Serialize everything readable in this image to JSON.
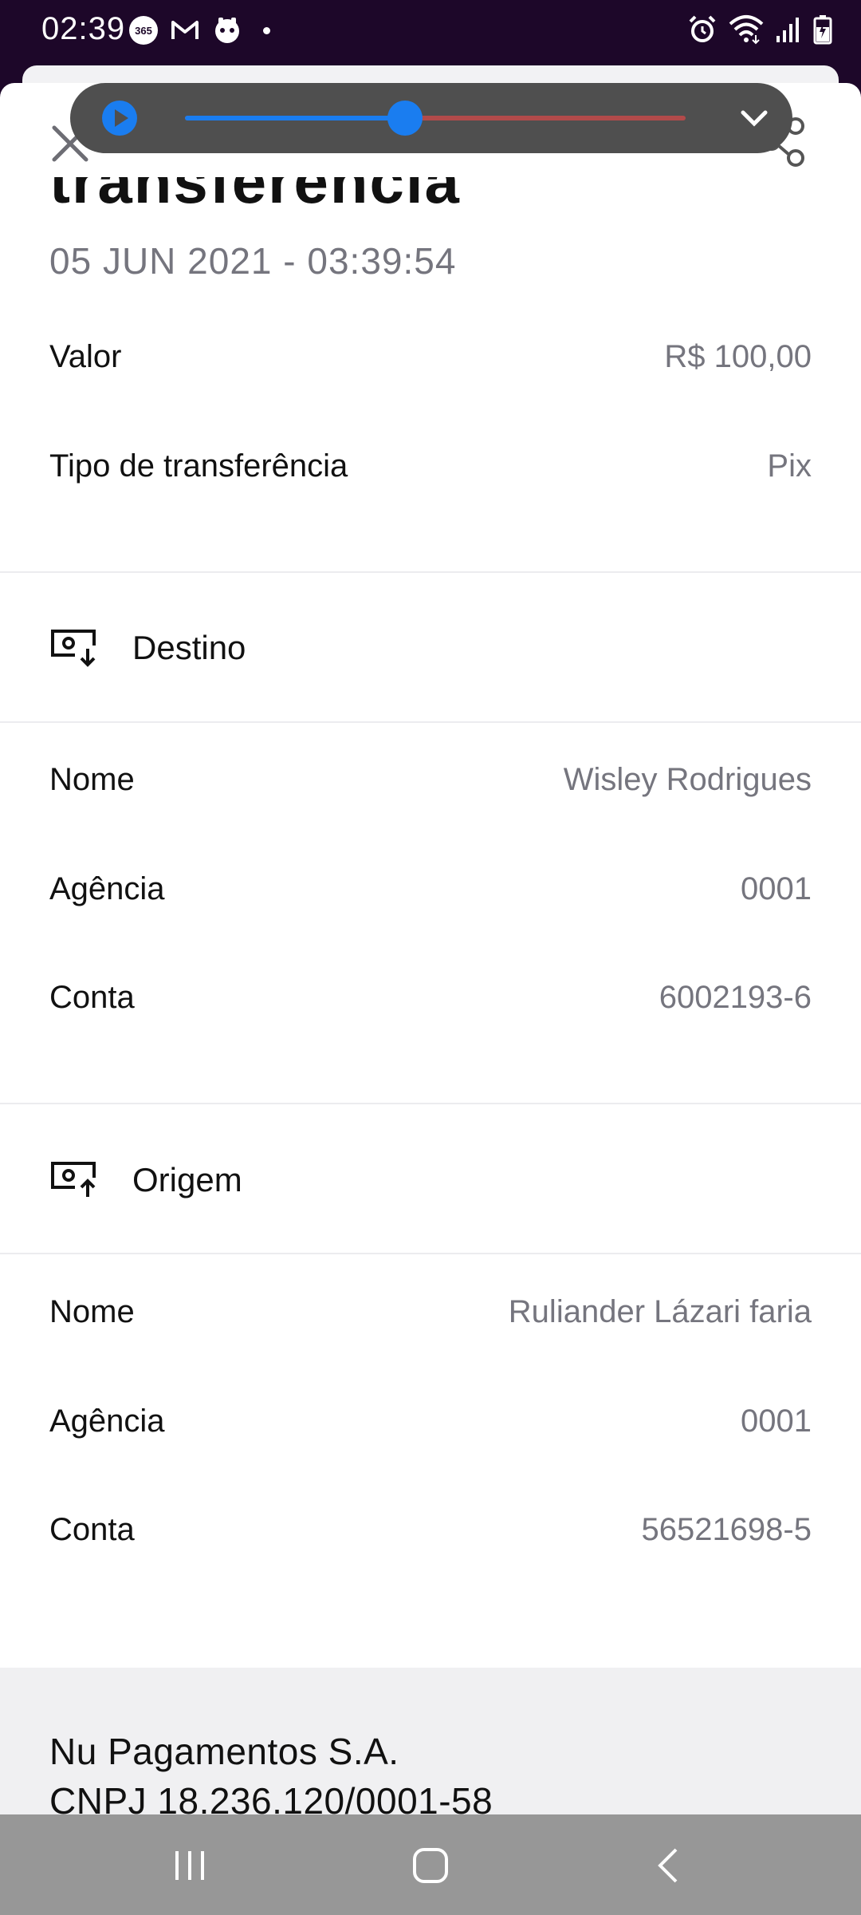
{
  "status_bar": {
    "time": "02:39",
    "left_icons": [
      "office-365-icon",
      "gmail-icon",
      "assistant-icon",
      "notification-dot"
    ],
    "right_icons": [
      "alarm-icon",
      "wifi-icon",
      "signal-icon",
      "battery-icon"
    ],
    "office_badge": "365"
  },
  "media_player": {
    "progress_fraction": 0.44,
    "colors": {
      "played": "#1a7df0",
      "remaining": "#b24a4a",
      "background": "#4f4f4f"
    }
  },
  "header": {
    "close_icon": "close-icon",
    "share_icon": "share-icon",
    "title_partial": "transferência"
  },
  "transfer": {
    "date": "05 JUN 2021 - 03:39:54",
    "value_label": "Valor",
    "value": "R$ 100,00",
    "type_label": "Tipo de transferência",
    "type": "Pix"
  },
  "destino": {
    "heading": "Destino",
    "icon": "receive-money-icon",
    "nome_label": "Nome",
    "nome": "Wisley Rodrigues",
    "agencia_label": "Agência",
    "agencia": "0001",
    "conta_label": "Conta",
    "conta": "6002193-6"
  },
  "origem": {
    "heading": "Origem",
    "icon": "send-money-icon",
    "nome_label": "Nome",
    "nome": "Ruliander Lázari faria",
    "agencia_label": "Agência",
    "agencia": "0001",
    "conta_label": "Conta",
    "conta": "56521698-5"
  },
  "footer": {
    "company": "Nu Pagamentos S.A.",
    "cnpj": "CNPJ 18.236.120/0001-58"
  },
  "nav_bar": {
    "buttons": [
      "recent-apps-icon",
      "home-icon",
      "back-icon"
    ]
  }
}
